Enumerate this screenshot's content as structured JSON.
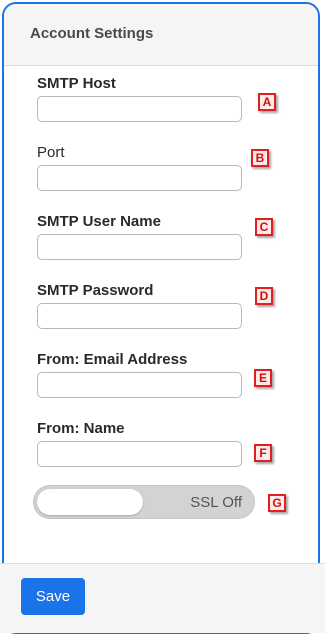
{
  "panel": {
    "title": "Account Settings"
  },
  "fields": {
    "smtp_host": {
      "label": "SMTP Host",
      "value": "",
      "marker": "A"
    },
    "port": {
      "label": "Port",
      "value": "",
      "marker": "B"
    },
    "smtp_user_name": {
      "label": "SMTP User Name",
      "value": "",
      "marker": "C"
    },
    "smtp_password": {
      "label": "SMTP Password",
      "value": "",
      "marker": "D"
    },
    "from_email": {
      "label": "From: Email Address",
      "value": "",
      "marker": "E"
    },
    "from_name": {
      "label": "From: Name",
      "value": "",
      "marker": "F"
    }
  },
  "ssl_toggle": {
    "label": "SSL Off",
    "state": "off",
    "marker": "G"
  },
  "footer": {
    "save_label": "Save"
  },
  "colors": {
    "accent": "#1a73e8",
    "marker_border": "#e02020",
    "marker_text": "#d01010",
    "toggle_track": "#d3d3d3"
  }
}
